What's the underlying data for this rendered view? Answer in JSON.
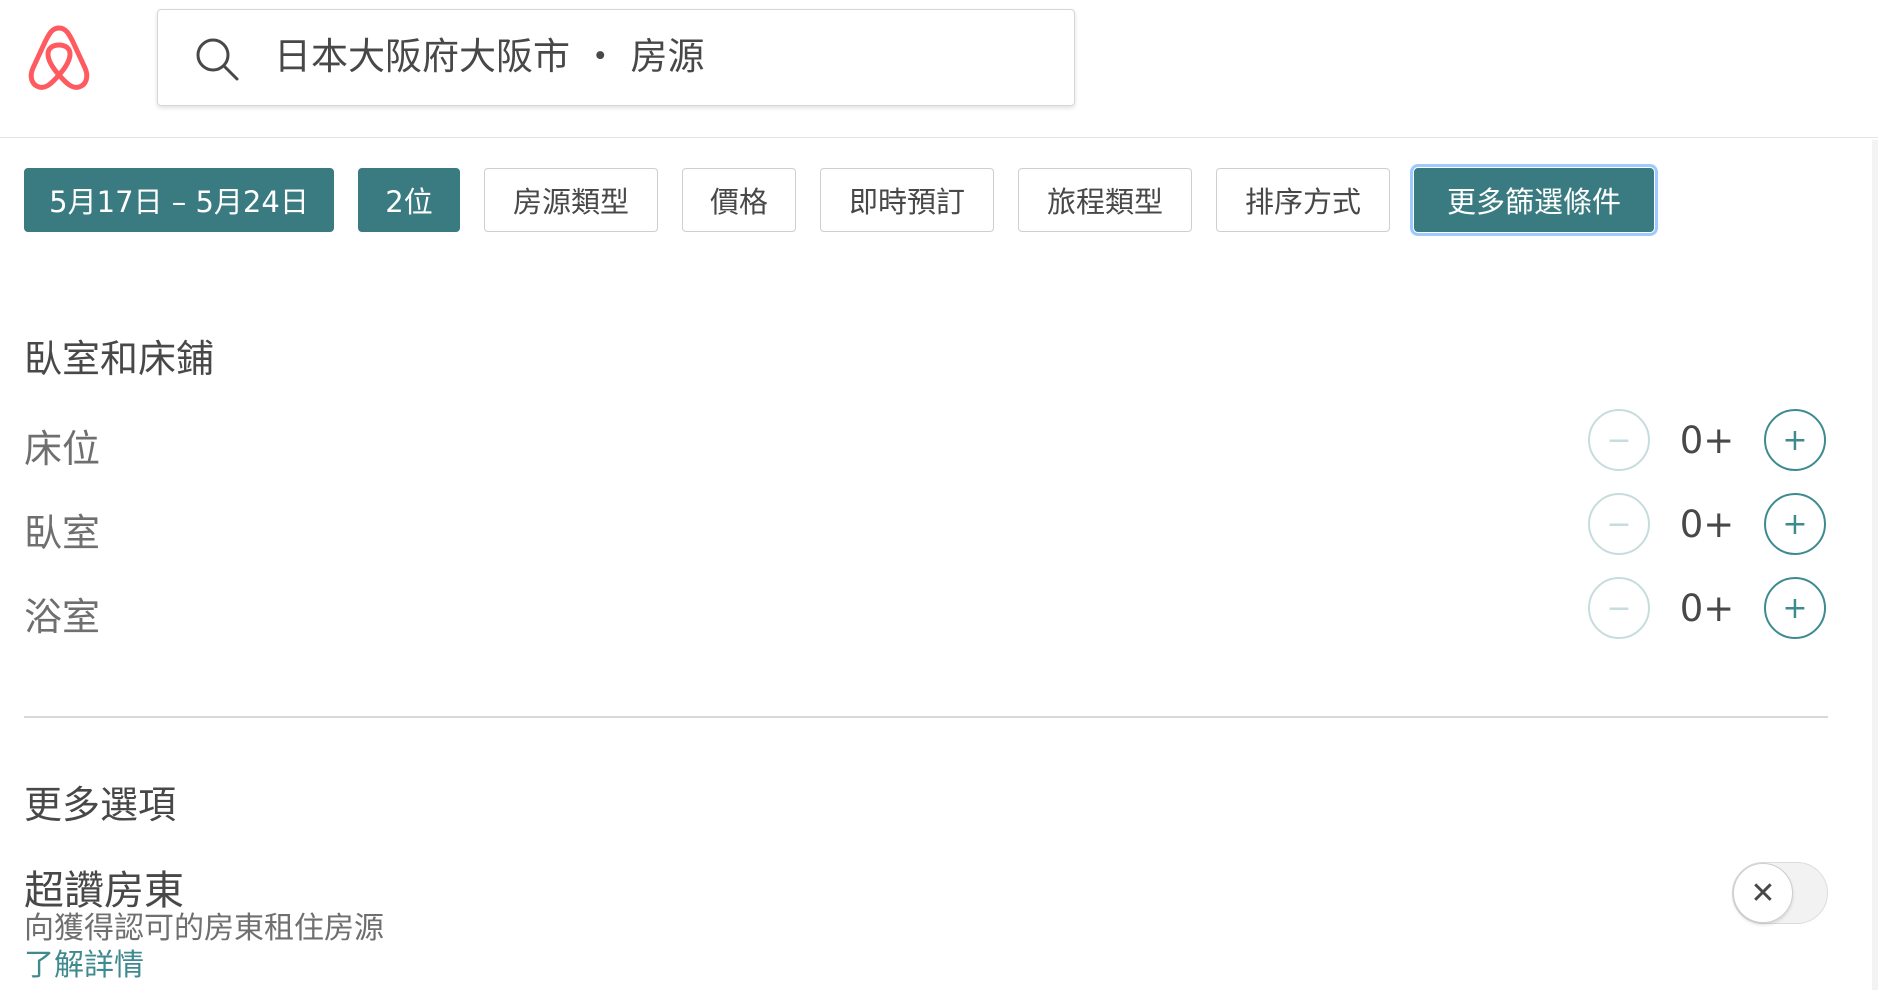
{
  "header": {
    "logo_icon": "airbnb-logo-icon",
    "search": {
      "icon": "search-icon",
      "text": "日本大阪府大阪市 ・ 房源"
    }
  },
  "filters": [
    {
      "label": "5月17日 – 5月24日",
      "active": true
    },
    {
      "label": "2位",
      "active": true
    },
    {
      "label": "房源類型",
      "active": false
    },
    {
      "label": "價格",
      "active": false
    },
    {
      "label": "即時預訂",
      "active": false
    },
    {
      "label": "旅程類型",
      "active": false
    },
    {
      "label": "排序方式",
      "active": false
    },
    {
      "label": "更多篩選條件",
      "active": true,
      "focused": true
    }
  ],
  "rooms": {
    "title": "臥室和床鋪",
    "rows": [
      {
        "label": "床位",
        "value": "0+",
        "minus": "−",
        "plus": "+"
      },
      {
        "label": "臥室",
        "value": "0+",
        "minus": "−",
        "plus": "+"
      },
      {
        "label": "浴室",
        "value": "0+",
        "minus": "−",
        "plus": "+"
      }
    ]
  },
  "more_options": {
    "title": "更多選項",
    "superhost": {
      "title": "超讚房東",
      "description": "向獲得認可的房東租住房源",
      "link": "了解詳情",
      "toggle_icon": "close-icon",
      "toggle_symbol": "✕",
      "enabled": false
    }
  },
  "colors": {
    "accent": "#397b80",
    "text": "#484848",
    "muted": "#6f6f6f",
    "logo": "#ff5a5f"
  }
}
